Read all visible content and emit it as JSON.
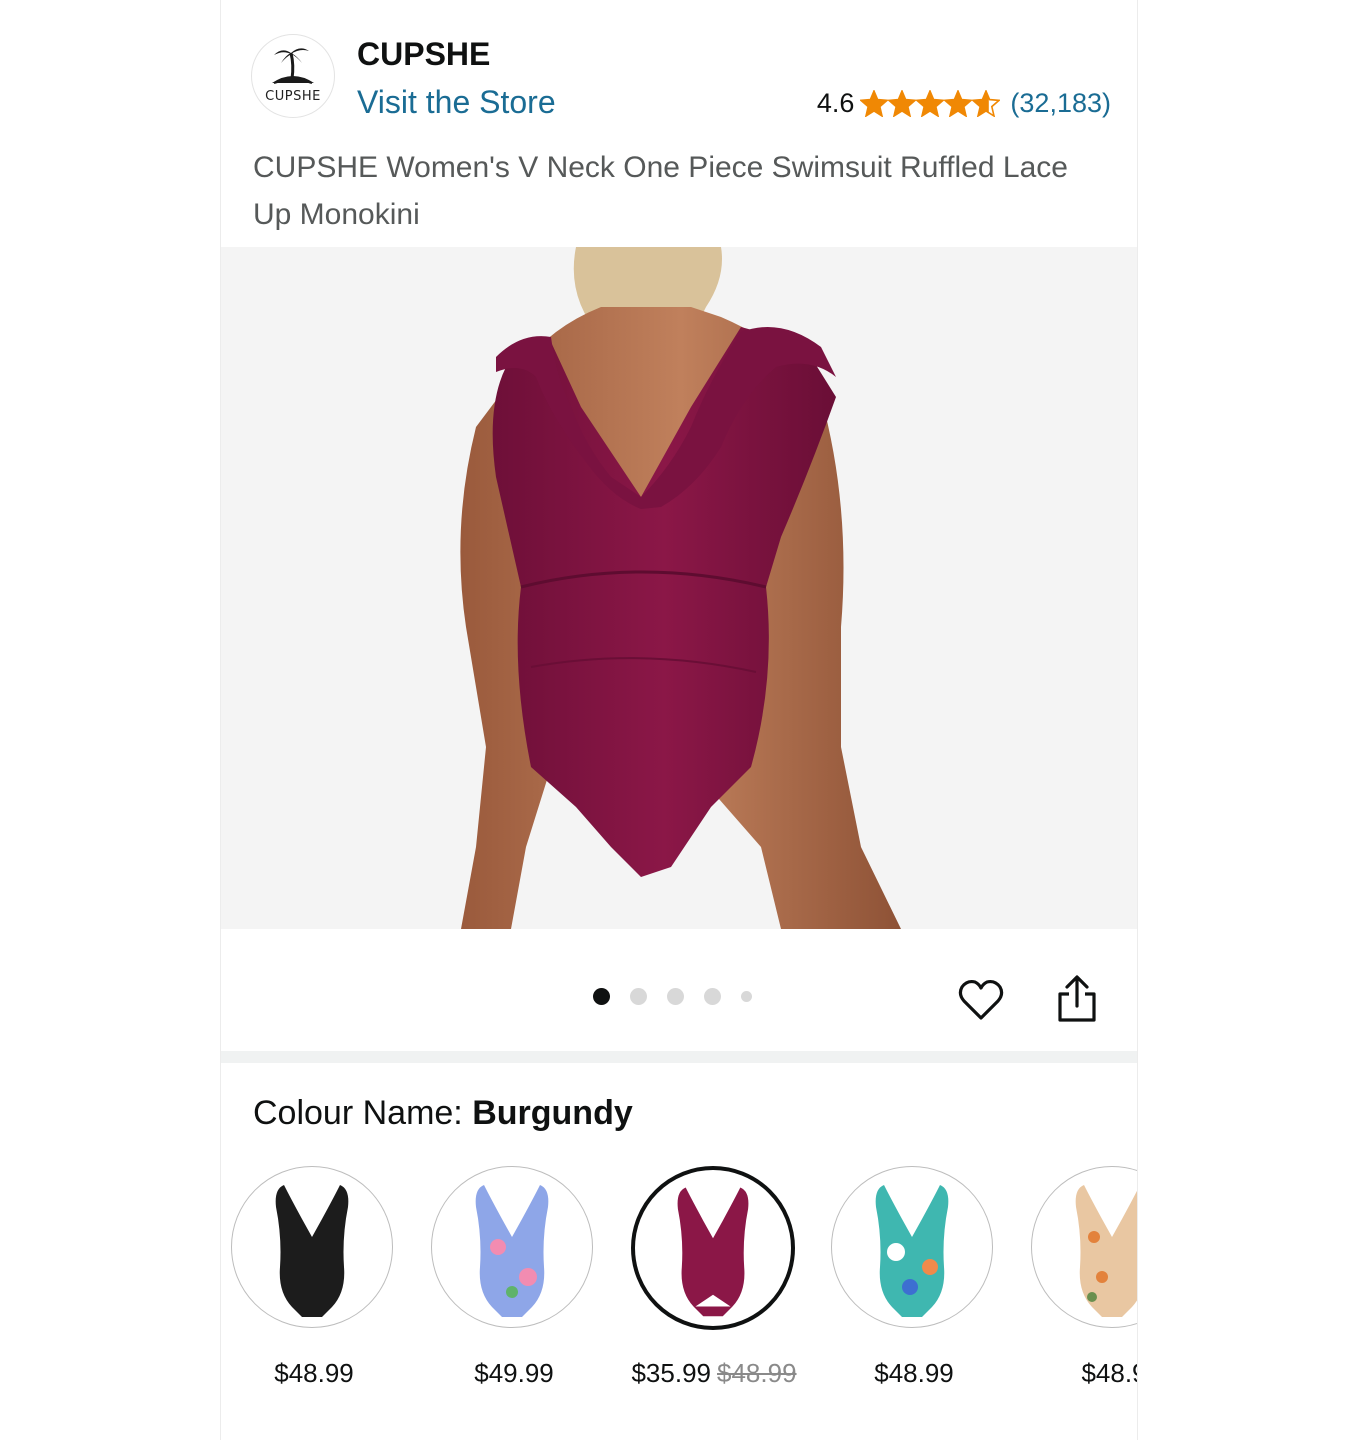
{
  "brand": {
    "logo_text": "CUPSHE",
    "name": "CUPSHE",
    "visit_label": "Visit the Store"
  },
  "rating": {
    "value": "4.6",
    "stars_out_of_5": 4.6,
    "count": "(32,183)",
    "star_color": "#f08804"
  },
  "product": {
    "title": "CUPSHE Women's V Neck One Piece Swimsuit Ruffled Lace Up Monokini",
    "swimsuit_color": "#8b1747"
  },
  "gallery": {
    "image_count": 5,
    "active_index": 0
  },
  "actions": {
    "wishlist_icon": "heart-icon",
    "share_icon": "share-icon"
  },
  "colour": {
    "label": "Colour Name: ",
    "selected": "Burgundy"
  },
  "swatches": [
    {
      "price": "$48.99",
      "old_price": "",
      "color": "#1c1c1c",
      "selected": false
    },
    {
      "price": "$49.99",
      "old_price": "",
      "color": "#8ea6e8",
      "selected": false
    },
    {
      "price": "$35.99",
      "old_price": "$48.99",
      "color": "#8b1747",
      "selected": true
    },
    {
      "price": "$48.99",
      "old_price": "",
      "color": "#3fb7b0",
      "selected": false
    },
    {
      "price": "$48.9",
      "old_price": "",
      "color": "#e9c7a2",
      "selected": false
    }
  ]
}
